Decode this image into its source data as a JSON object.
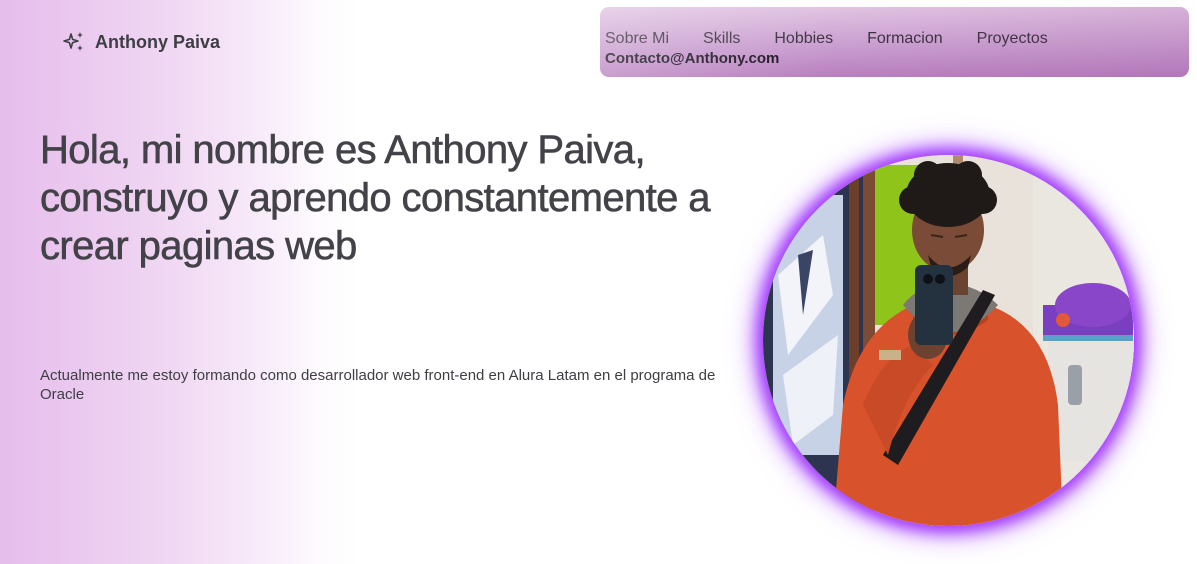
{
  "brand": {
    "icon": "sparkles-icon",
    "name": "Anthony Paiva"
  },
  "nav": {
    "links": [
      "Sobre Mi",
      "Skills",
      "Hobbies",
      "Formacion",
      "Proyectos"
    ],
    "contact": "Contacto@Anthony.com"
  },
  "hero": {
    "title": "Hola, mi nombre es Anthony Paiva, construyo y aprendo constantemente a crear paginas web",
    "description": "Actualmente me estoy formando como desarrollador web front-end en Alura Latam en el programa de Oracle"
  },
  "colors": {
    "accent_glow": "#a238ff",
    "nav_bg": "#c99ed0",
    "text": "#424248",
    "hoodie": "#d8522c"
  }
}
